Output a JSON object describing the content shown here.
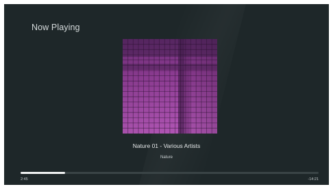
{
  "header": {
    "title": "Now Playing"
  },
  "album_art": {
    "description_icon": "album-art-grid",
    "accent": "#9b3e9d"
  },
  "track": {
    "line": "Nature 01 - Various Artists",
    "album": "Nature"
  },
  "progress": {
    "elapsed": "2:45",
    "remaining": "-14:21",
    "fraction": 0.15
  },
  "colors": {
    "background": "#1e2729",
    "text": "#e6e9ea",
    "progress_track": "#3a4446",
    "progress_fill": "#f2f4f4"
  }
}
